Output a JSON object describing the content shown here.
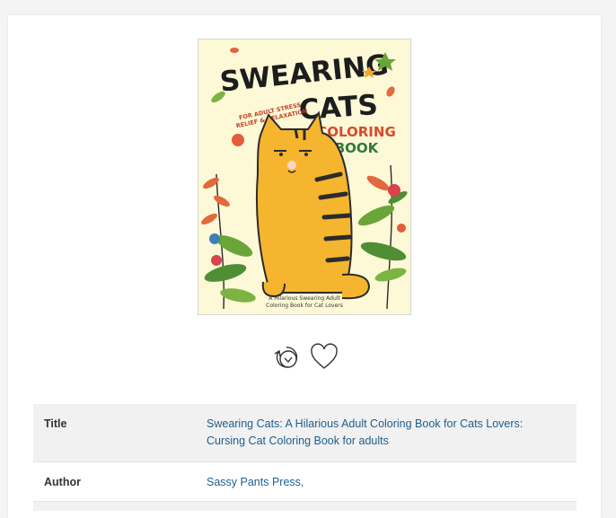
{
  "book": {
    "cover": {
      "line1": "SWEARING",
      "line2": "CATS",
      "line3": "COLORING",
      "line4": "BOOK",
      "tagline1": "FOR ADULT STRESS",
      "tagline2": "RELIEF & RELAXATION",
      "footer1": "A Hilarious Swearing Adult",
      "footer2": "Coloring Book for Cat Lovers"
    }
  },
  "actions": {
    "history_icon": "history-clock-icon",
    "favorite_icon": "heart-outline-icon"
  },
  "details": {
    "title_label": "Title",
    "title_line1": "Swearing Cats: A Hilarious Adult Coloring Book for Cats Lovers:",
    "title_line2": "Cursing Cat Coloring Book for adults",
    "author_label": "Author",
    "author_value": "Sassy Pants Press,"
  },
  "colors": {
    "link": "#1f5e8c",
    "row_shade": "#f1f1f1",
    "cover_bg": "#fdf8d6",
    "cat": "#f5b52e"
  }
}
